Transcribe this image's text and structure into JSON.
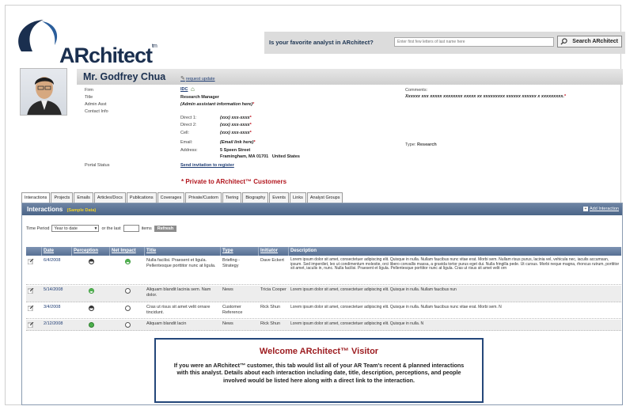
{
  "brand": {
    "logo_text": "ARchitect",
    "logo_tm": "tm"
  },
  "search": {
    "question": "Is your favorite analyst in ARchitect?",
    "placeholder": "Enter first few letters of last name here",
    "button_label": "Search ARchitect"
  },
  "profile": {
    "name": "Mr. Godfrey Chua",
    "request_update": "request update",
    "fields": {
      "firm_label": "Firm",
      "firm_value": "IDC",
      "title_label": "Title",
      "title_value": "Research Manager",
      "admin_label": "Admin Asst",
      "admin_value": "(Admin assistant information here)",
      "contact_label": "Contact Info",
      "direct1_label": "Direct 1:",
      "direct1_value": "(xxx) xxx-xxxx",
      "direct2_label": "Direct 2:",
      "direct2_value": "(xxx) xxx-xxxx",
      "cell_label": "Cell:",
      "cell_value": "(xxx) xxx-xxxx",
      "email_label": "Email:",
      "email_value": "(Email link here)",
      "address_label": "Address:",
      "address_line1": "5 Speen Street",
      "address_line2": "Framingham, MA 01701   United States",
      "portal_label": "Portal Status",
      "portal_value": "Send invitation to register"
    },
    "comments_label": "Comments:",
    "comments_value": "Xxxxxx xxx xxxxx xxxxxxxx xxxxx xx xxxxxxxxx xxxxxx xxxxxx x xxxxxxxxx.",
    "type_label": "Type:",
    "type_value": "Research",
    "private_note": "* Private to ARchitect™ Customers",
    "required_mark": "*"
  },
  "tabs": [
    "Interactions",
    "Projects",
    "Emails",
    "Articles/Docs",
    "Publications",
    "Coverages",
    "Private/Custom",
    "Tiering",
    "Biography",
    "Events",
    "Links",
    "Analyst Groups"
  ],
  "panel": {
    "title": "Interactions",
    "sample": "(Sample Data)",
    "add_label": "Add Interaction",
    "time_period_label": "Time Period",
    "time_period_value": "Year to date",
    "or_the_last": "or the last",
    "items_label": "items",
    "refresh_label": "Refresh"
  },
  "table": {
    "headers": [
      "Date",
      "Perception",
      "Net Impact",
      "Title",
      "Type",
      "Initiator",
      "Description"
    ],
    "rows": [
      {
        "date": "6/4/2008",
        "title": "Nulla facilisi. Praesent et ligula. Pellentesque porttitor nunc at ligula.",
        "type": "Briefing - Strategy",
        "initiator": "Dave Eckert",
        "description": "Lorem ipsum dolor sit amet, consectetuer adipiscing elit. Quisque in nulla. Nullam faucibus nunc vitae erat. Morbi sem. Nullam risus purus, lacinia vel, vehicula nec, iaculis accumsan, ipsum. Sed imperdiet, leo ut condimentum molestie, orci libero convallis massa, a gravida tortor purus eget dui. Nulla fringilla pede. Ut cursus. Morbi neque magna, rhoncus rutrum, porttitor sit amet, iaculis in, nunc. Nulla facilisi. Praesent et ligula. Pellentesque porttitor nunc at ligula. Cras ut risus sit amet velit orn"
      },
      {
        "date": "5/14/2008",
        "title": "Aliquam blandit lacinia sem. Nam dolor.",
        "type": "News",
        "initiator": "Tricia Cooper",
        "description": "Lorem ipsum dolor sit amet, consectetuer adipiscing elit. Quisque in nulla. Nullam faucibus nun"
      },
      {
        "date": "3/4/2008",
        "title": "Cras ut risus sit amet velit ornare tincidunt.",
        "type": "Customer Reference",
        "initiator": "Rick Shun",
        "description": "Lorem ipsum dolor sit amet, consectetuer adipiscing elit. Quisque in nulla. Nullam faucibus nunc vitae erat. Morbi sem. N"
      },
      {
        "date": "2/12/2008",
        "title": "Aliquam blandit lacin",
        "type": "News",
        "initiator": "Rick Shun",
        "description": "Lorem ipsum dolor sit amet, consectetuer adipiscing elit. Quisque in nulla. N"
      }
    ]
  },
  "welcome": {
    "title": "Welcome ARchitect™ Visitor",
    "body": "If you were an ARchitect™ customer, this tab would list all of your AR Team's recent & planned interactions with this analyst. Details about each interaction including date, title, description, perceptions, and people involved would be listed here along with a direct link to the interaction."
  },
  "colors": {
    "brand_navy": "#1a2f4f",
    "accent_red": "#c4121e",
    "header_blue": "#566f93"
  }
}
